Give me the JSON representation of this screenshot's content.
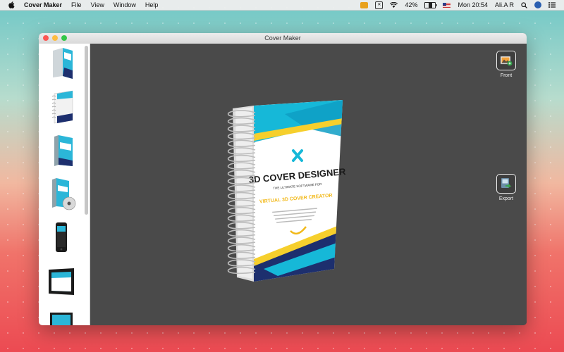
{
  "menubar": {
    "app_name": "Cover Maker",
    "items": [
      "File",
      "View",
      "Window",
      "Help"
    ],
    "battery": "42%",
    "battery_level": 0.42,
    "clock": "Mon 20:54",
    "user": "Ali.A R"
  },
  "window": {
    "title": "Cover Maker"
  },
  "sidebar": {
    "templates": [
      {
        "name": "software-box"
      },
      {
        "name": "spiral-notebook"
      },
      {
        "name": "dvd-box"
      },
      {
        "name": "dvd-box-with-disc"
      },
      {
        "name": "phone"
      },
      {
        "name": "tablet"
      },
      {
        "name": "laptop"
      }
    ]
  },
  "canvas": {
    "cover": {
      "title": "3D COVER DESIGNER",
      "subtitle": "VIRTUAL 3D COVER CREATOR",
      "tagline": "THE ULTIMATE SOFTWARE FOR",
      "colors": {
        "primary": "#16b8d8",
        "accent": "#f6cf2c",
        "dark": "#1d2f6e"
      }
    },
    "tools": [
      {
        "label": "Front",
        "icon": "front-image-icon"
      },
      {
        "label": "Export",
        "icon": "export-icon"
      }
    ]
  }
}
